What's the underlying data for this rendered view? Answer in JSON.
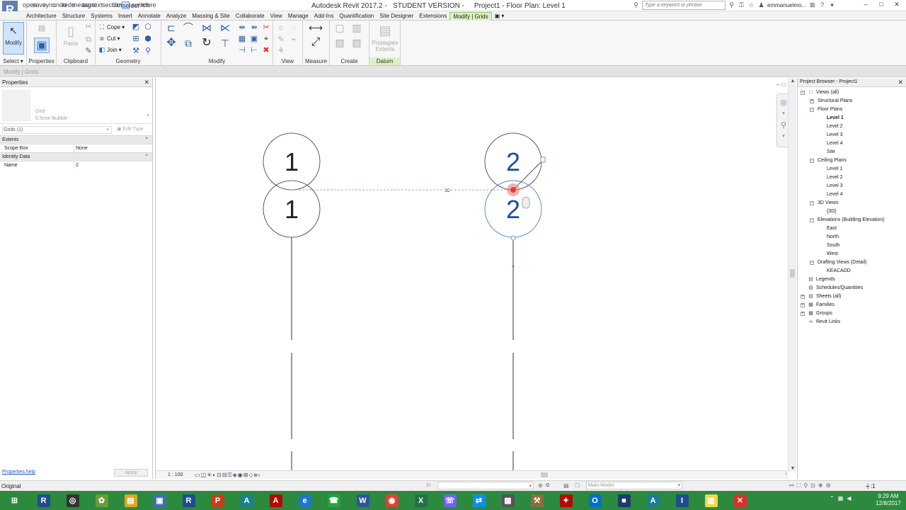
{
  "window": {
    "title": "Autodesk Revit 2017.2 -   STUDENT VERSION -     Project1 - Floor Plan: Level 1",
    "app_initial": "R",
    "search_placeholder": "Type a keyword or phrase",
    "user": "emmanuelmo...",
    "controls": [
      "–",
      "□",
      "✕"
    ]
  },
  "quick_access": [
    "open",
    "save",
    "sync",
    "undo",
    "redo",
    "measure",
    "tag",
    "text",
    "section",
    "close",
    "select",
    "switch",
    "more"
  ],
  "tabs": [
    {
      "label": "Architecture",
      "active": false
    },
    {
      "label": "Structure",
      "active": false
    },
    {
      "label": "Systems",
      "active": false
    },
    {
      "label": "Insert",
      "active": false
    },
    {
      "label": "Annotate",
      "active": false
    },
    {
      "label": "Analyze",
      "active": false
    },
    {
      "label": "Massing & Site",
      "active": false
    },
    {
      "label": "Collaborate",
      "active": false
    },
    {
      "label": "View",
      "active": false
    },
    {
      "label": "Manage",
      "active": false
    },
    {
      "label": "Add-Ins",
      "active": false
    },
    {
      "label": "Quantification",
      "active": false
    },
    {
      "label": "Site Designer",
      "active": false
    },
    {
      "label": "Extensions",
      "active": false
    },
    {
      "label": "Modify | Grids",
      "active": true
    },
    {
      "label": "▣ ▾",
      "active": false
    }
  ],
  "ribbon": {
    "panels": {
      "select": "Select",
      "properties": "Properties",
      "clipboard": "Clipboard",
      "geometry": "Geometry",
      "modify": "Modify",
      "view": "View",
      "measure": "Measure",
      "create": "Create",
      "datum": "Datum"
    },
    "buttons": {
      "modify": "Modify",
      "paste": "Paste",
      "cope": "Cope",
      "cut": "Cut",
      "join": "Join",
      "propagate_1": "Propagate",
      "propagate_2": "Extents"
    }
  },
  "context_bar": "Modify | Grids",
  "properties": {
    "title": "Properties",
    "type_family": "Grid",
    "type_name": "6.5mm Bubble",
    "instance_filter": "Grids (1)",
    "edit_type": "Edit Type",
    "groups": [
      {
        "name": "Extents",
        "rows": [
          {
            "name": "Scope Box",
            "value": "None"
          }
        ]
      },
      {
        "name": "Identity Data",
        "rows": [
          {
            "name": "Name",
            "value": "2"
          }
        ]
      }
    ],
    "help_link": "Properties help",
    "apply": "Apply"
  },
  "canvas": {
    "grids": [
      {
        "label_top": "1",
        "label_bottom": "1",
        "selected": false
      },
      {
        "label_top": "2",
        "label_bottom": "2",
        "selected": true
      }
    ],
    "dimension_tag": "3D",
    "scale": "1 : 100",
    "view_controls": [
      "–",
      "□",
      "✕"
    ]
  },
  "browser": {
    "title": "Project Browser - Project1",
    "nodes": [
      {
        "label": "Views (all)",
        "level": 0,
        "toggle": "−",
        "icon": "□",
        "selected": false
      },
      {
        "label": "Structural Plans",
        "level": 1,
        "toggle": "+",
        "icon": "",
        "selected": false
      },
      {
        "label": "Floor Plans",
        "level": 1,
        "toggle": "−",
        "icon": "",
        "selected": false
      },
      {
        "label": "Level 1",
        "level": 2,
        "toggle": "",
        "icon": "",
        "selected": true
      },
      {
        "label": "Level 2",
        "level": 2,
        "toggle": "",
        "icon": "",
        "selected": false
      },
      {
        "label": "Level 3",
        "level": 2,
        "toggle": "",
        "icon": "",
        "selected": false
      },
      {
        "label": "Level 4",
        "level": 2,
        "toggle": "",
        "icon": "",
        "selected": false
      },
      {
        "label": "Site",
        "level": 2,
        "toggle": "",
        "icon": "",
        "selected": false
      },
      {
        "label": "Ceiling Plans",
        "level": 1,
        "toggle": "−",
        "icon": "",
        "selected": false
      },
      {
        "label": "Level 1",
        "level": 2,
        "toggle": "",
        "icon": "",
        "selected": false
      },
      {
        "label": "Level 2",
        "level": 2,
        "toggle": "",
        "icon": "",
        "selected": false
      },
      {
        "label": "Level 3",
        "level": 2,
        "toggle": "",
        "icon": "",
        "selected": false
      },
      {
        "label": "Level 4",
        "level": 2,
        "toggle": "",
        "icon": "",
        "selected": false
      },
      {
        "label": "3D Views",
        "level": 1,
        "toggle": "−",
        "icon": "",
        "selected": false
      },
      {
        "label": "{3D}",
        "level": 2,
        "toggle": "",
        "icon": "",
        "selected": false
      },
      {
        "label": "Elevations (Building Elevation)",
        "level": 1,
        "toggle": "−",
        "icon": "",
        "selected": false
      },
      {
        "label": "East",
        "level": 2,
        "toggle": "",
        "icon": "",
        "selected": false
      },
      {
        "label": "North",
        "level": 2,
        "toggle": "",
        "icon": "",
        "selected": false
      },
      {
        "label": "South",
        "level": 2,
        "toggle": "",
        "icon": "",
        "selected": false
      },
      {
        "label": "West",
        "level": 2,
        "toggle": "",
        "icon": "",
        "selected": false
      },
      {
        "label": "Drafting Views (Detail)",
        "level": 1,
        "toggle": "−",
        "icon": "",
        "selected": false
      },
      {
        "label": "KEACADD",
        "level": 2,
        "toggle": "",
        "icon": "",
        "selected": false
      },
      {
        "label": "Legends",
        "level": 0,
        "toggle": "",
        "icon": "▤",
        "selected": false
      },
      {
        "label": "Schedules/Quantities",
        "level": 0,
        "toggle": "",
        "icon": "▤",
        "selected": false
      },
      {
        "label": "Sheets (all)",
        "level": 0,
        "toggle": "+",
        "icon": "▤",
        "selected": false
      },
      {
        "label": "Families",
        "level": 0,
        "toggle": "+",
        "icon": "▦",
        "selected": false
      },
      {
        "label": "Groups",
        "level": 0,
        "toggle": "+",
        "icon": "▦",
        "selected": false
      },
      {
        "label": "Revit Links",
        "level": 0,
        "toggle": "",
        "icon": "∞",
        "selected": false
      }
    ]
  },
  "status": {
    "text": "Original",
    "zero": ":0",
    "model": "Main Model",
    "filter": ":1"
  },
  "taskbar": {
    "apps": [
      {
        "name": "start",
        "glyph": "⊞",
        "color": "#2b8a3e"
      },
      {
        "name": "revit",
        "glyph": "R",
        "color": "#1f4e8c"
      },
      {
        "name": "chrome-alt",
        "glyph": "◎",
        "color": "#333333"
      },
      {
        "name": "app-3",
        "glyph": "✿",
        "color": "#6a9b3a"
      },
      {
        "name": "explorer",
        "glyph": "▤",
        "color": "#e0a526"
      },
      {
        "name": "save",
        "glyph": "▣",
        "color": "#3d6fb4"
      },
      {
        "name": "revit-2",
        "glyph": "R",
        "color": "#1f4e8c"
      },
      {
        "name": "powerpoint",
        "glyph": "P",
        "color": "#c43e1c"
      },
      {
        "name": "autocad",
        "glyph": "A",
        "color": "#1a7f8f"
      },
      {
        "name": "acrobat",
        "glyph": "A",
        "color": "#b30b00"
      },
      {
        "name": "edge",
        "glyph": "e",
        "color": "#1e78c8"
      },
      {
        "name": "whatsapp",
        "glyph": "☎",
        "color": "#25a244"
      },
      {
        "name": "word",
        "glyph": "W",
        "color": "#2b579a"
      },
      {
        "name": "chrome",
        "glyph": "◉",
        "color": "#db4437"
      },
      {
        "name": "excel",
        "glyph": "X",
        "color": "#217346"
      },
      {
        "name": "viber",
        "glyph": "☏",
        "color": "#7360f2"
      },
      {
        "name": "teamviewer",
        "glyph": "⇄",
        "color": "#0e8ee9"
      },
      {
        "name": "calculator",
        "glyph": "▦",
        "color": "#555555"
      },
      {
        "name": "tool",
        "glyph": "⚒",
        "color": "#8a6d3b"
      },
      {
        "name": "pdf",
        "glyph": "✦",
        "color": "#b30b00"
      },
      {
        "name": "outlook",
        "glyph": "O",
        "color": "#0072c6"
      },
      {
        "name": "terminal",
        "glyph": "■",
        "color": "#1a3d6e"
      },
      {
        "name": "autocad-2",
        "glyph": "A",
        "color": "#1a7f8f"
      },
      {
        "name": "autodesk",
        "glyph": "I",
        "color": "#1f4e8c"
      },
      {
        "name": "notes",
        "glyph": "▥",
        "color": "#f2d54a"
      },
      {
        "name": "sketch",
        "glyph": "✕",
        "color": "#d9302c"
      }
    ],
    "time": "9:29 AM",
    "date": "12/8/2017"
  }
}
